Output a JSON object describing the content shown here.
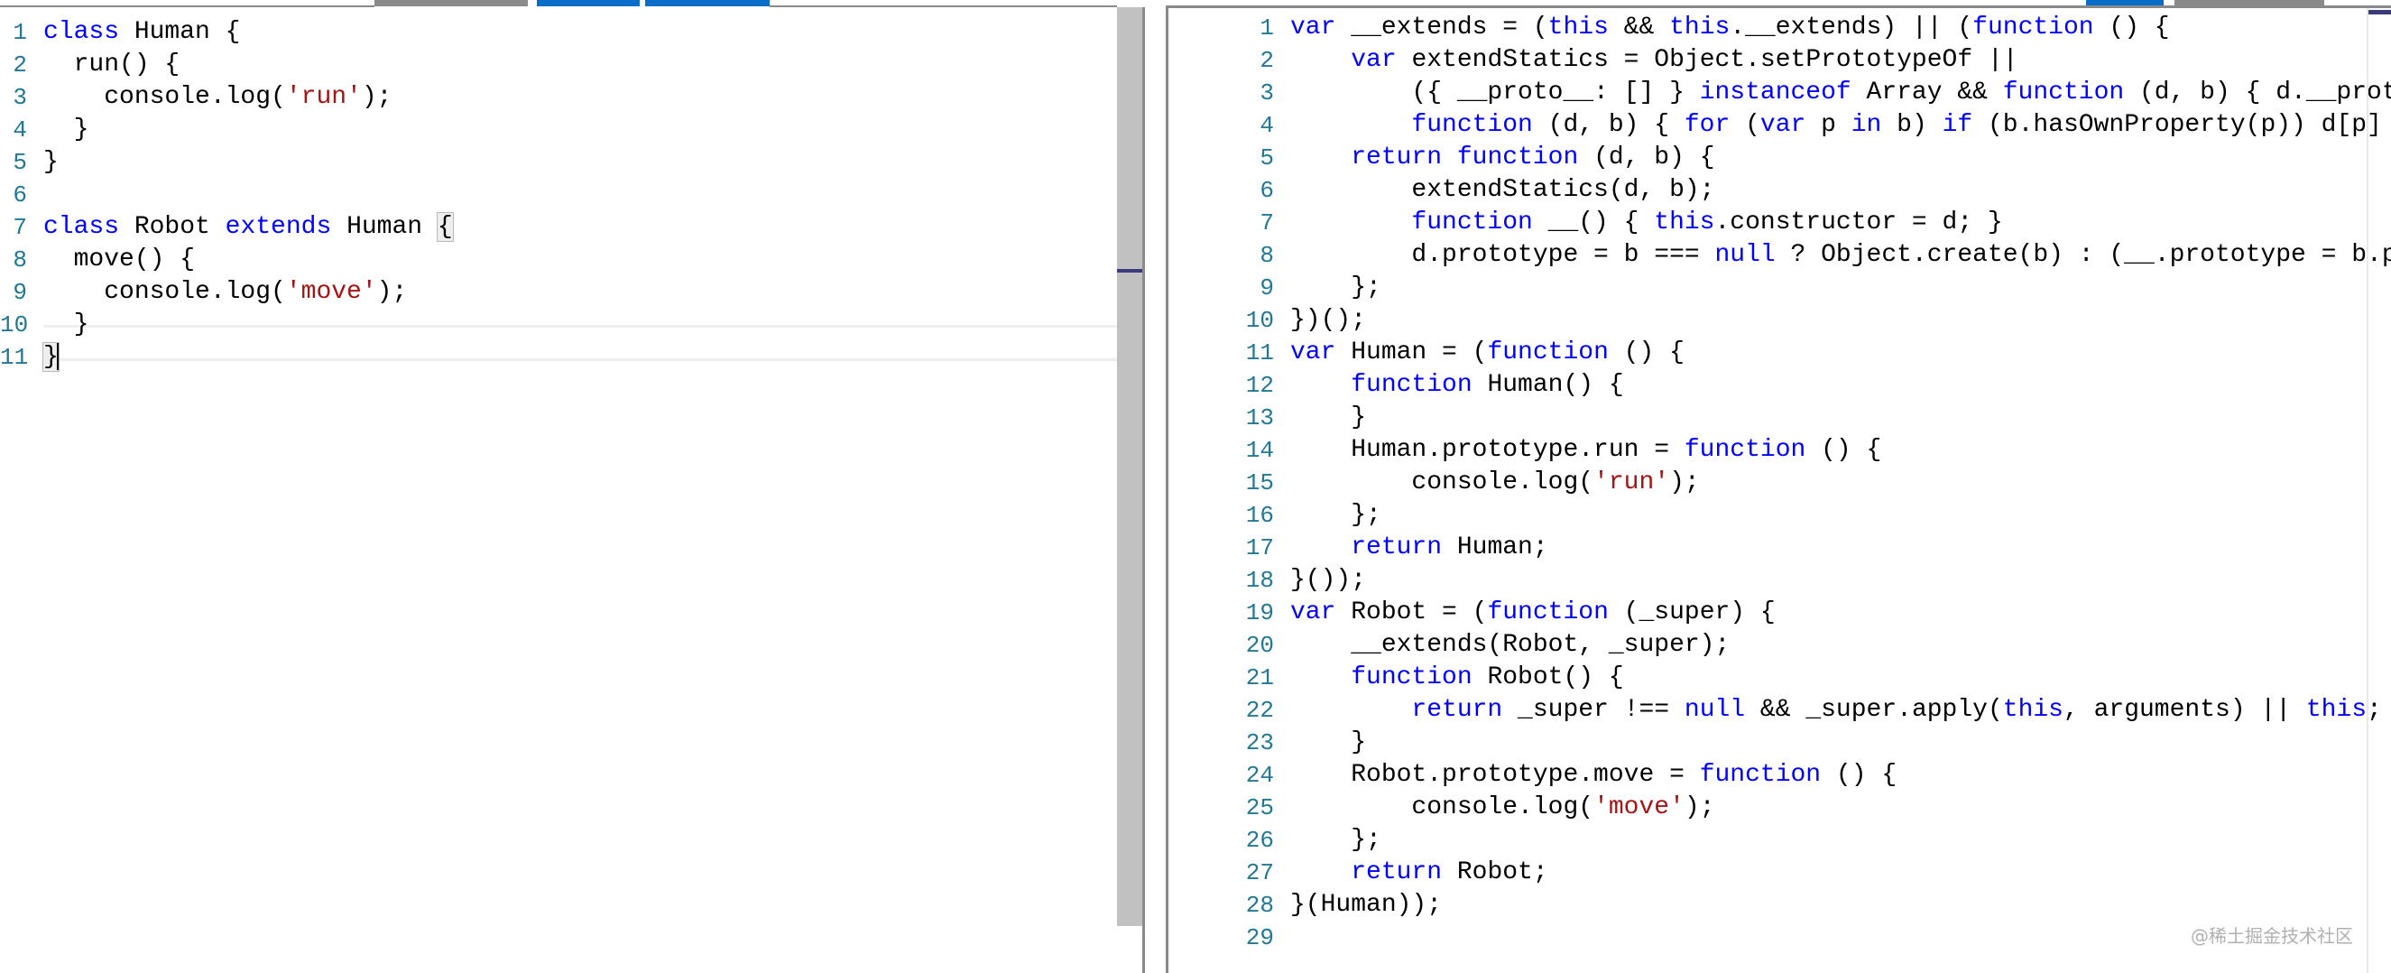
{
  "left_editor": {
    "language": "TypeScript",
    "cursor_line": 11,
    "lines": [
      {
        "n": "1",
        "tokens": [
          {
            "t": "class",
            "c": "kw"
          },
          {
            "t": " Human {"
          }
        ]
      },
      {
        "n": "2",
        "tokens": [
          {
            "t": "  run() {"
          }
        ]
      },
      {
        "n": "3",
        "tokens": [
          {
            "t": "    console.log("
          },
          {
            "t": "'run'",
            "c": "str"
          },
          {
            "t": ");"
          }
        ]
      },
      {
        "n": "4",
        "tokens": [
          {
            "t": "  }"
          }
        ]
      },
      {
        "n": "5",
        "tokens": [
          {
            "t": "}"
          }
        ]
      },
      {
        "n": "6",
        "tokens": []
      },
      {
        "n": "7",
        "tokens": [
          {
            "t": "class",
            "c": "kw"
          },
          {
            "t": " Robot "
          },
          {
            "t": "extends",
            "c": "kw"
          },
          {
            "t": " Human "
          },
          {
            "t": "{",
            "c": "bracket-match"
          }
        ]
      },
      {
        "n": "8",
        "tokens": [
          {
            "t": "  move() {"
          }
        ]
      },
      {
        "n": "9",
        "tokens": [
          {
            "t": "    console.log("
          },
          {
            "t": "'move'",
            "c": "str"
          },
          {
            "t": ");"
          }
        ]
      },
      {
        "n": "10",
        "tokens": [
          {
            "t": "  }"
          }
        ]
      },
      {
        "n": "11",
        "tokens": [
          {
            "t": "}",
            "c": "bracket-match"
          }
        ]
      }
    ]
  },
  "right_editor": {
    "language": "JavaScript",
    "lines": [
      {
        "n": "1",
        "tokens": [
          {
            "t": "var",
            "c": "kw"
          },
          {
            "t": " __extends = ("
          },
          {
            "t": "this",
            "c": "kw"
          },
          {
            "t": " && "
          },
          {
            "t": "this",
            "c": "kw"
          },
          {
            "t": ".__extends) || ("
          },
          {
            "t": "function",
            "c": "kw"
          },
          {
            "t": " () {"
          }
        ]
      },
      {
        "n": "2",
        "tokens": [
          {
            "t": "    "
          },
          {
            "t": "var",
            "c": "kw"
          },
          {
            "t": " extendStatics = Object.setPrototypeOf ||"
          }
        ]
      },
      {
        "n": "3",
        "tokens": [
          {
            "t": "        ({ __proto__: [] } "
          },
          {
            "t": "instanceof",
            "c": "kw"
          },
          {
            "t": " Array && "
          },
          {
            "t": "function",
            "c": "kw"
          },
          {
            "t": " (d, b) { d.__proto__ = b; }) ||"
          }
        ]
      },
      {
        "n": "4",
        "tokens": [
          {
            "t": "        "
          },
          {
            "t": "function",
            "c": "kw"
          },
          {
            "t": " (d, b) { "
          },
          {
            "t": "for",
            "c": "kw"
          },
          {
            "t": " ("
          },
          {
            "t": "var",
            "c": "kw"
          },
          {
            "t": " p "
          },
          {
            "t": "in",
            "c": "kw"
          },
          {
            "t": " b) "
          },
          {
            "t": "if",
            "c": "kw"
          },
          {
            "t": " (b.hasOwnProperty(p)) d[p] = b[p]; };"
          }
        ]
      },
      {
        "n": "5",
        "tokens": [
          {
            "t": "    "
          },
          {
            "t": "return",
            "c": "kw"
          },
          {
            "t": " "
          },
          {
            "t": "function",
            "c": "kw"
          },
          {
            "t": " (d, b) {"
          }
        ]
      },
      {
        "n": "6",
        "tokens": [
          {
            "t": "        extendStatics(d, b);"
          }
        ]
      },
      {
        "n": "7",
        "tokens": [
          {
            "t": "        "
          },
          {
            "t": "function",
            "c": "kw"
          },
          {
            "t": " __() { "
          },
          {
            "t": "this",
            "c": "kw"
          },
          {
            "t": ".constructor = d; }"
          }
        ]
      },
      {
        "n": "8",
        "tokens": [
          {
            "t": "        d.prototype = b === "
          },
          {
            "t": "null",
            "c": "kw"
          },
          {
            "t": " ? Object.create(b) : (__.prototype = b.prototype, new __());"
          }
        ]
      },
      {
        "n": "9",
        "tokens": [
          {
            "t": "    };"
          }
        ]
      },
      {
        "n": "10",
        "tokens": [
          {
            "t": "})();"
          }
        ]
      },
      {
        "n": "11",
        "tokens": [
          {
            "t": "var",
            "c": "kw"
          },
          {
            "t": " Human = ("
          },
          {
            "t": "function",
            "c": "kw"
          },
          {
            "t": " () {"
          }
        ]
      },
      {
        "n": "12",
        "tokens": [
          {
            "t": "    "
          },
          {
            "t": "function",
            "c": "kw"
          },
          {
            "t": " Human() {"
          }
        ]
      },
      {
        "n": "13",
        "tokens": [
          {
            "t": "    }"
          }
        ]
      },
      {
        "n": "14",
        "tokens": [
          {
            "t": "    Human.prototype.run = "
          },
          {
            "t": "function",
            "c": "kw"
          },
          {
            "t": " () {"
          }
        ]
      },
      {
        "n": "15",
        "tokens": [
          {
            "t": "        console.log("
          },
          {
            "t": "'run'",
            "c": "str"
          },
          {
            "t": ");"
          }
        ]
      },
      {
        "n": "16",
        "tokens": [
          {
            "t": "    };"
          }
        ]
      },
      {
        "n": "17",
        "tokens": [
          {
            "t": "    "
          },
          {
            "t": "return",
            "c": "kw"
          },
          {
            "t": " Human;"
          }
        ]
      },
      {
        "n": "18",
        "tokens": [
          {
            "t": "}());"
          }
        ]
      },
      {
        "n": "19",
        "tokens": [
          {
            "t": "var",
            "c": "kw"
          },
          {
            "t": " Robot = ("
          },
          {
            "t": "function",
            "c": "kw"
          },
          {
            "t": " (_super) {"
          }
        ]
      },
      {
        "n": "20",
        "tokens": [
          {
            "t": "    __extends(Robot, _super);"
          }
        ]
      },
      {
        "n": "21",
        "tokens": [
          {
            "t": "    "
          },
          {
            "t": "function",
            "c": "kw"
          },
          {
            "t": " Robot() {"
          }
        ]
      },
      {
        "n": "22",
        "tokens": [
          {
            "t": "        "
          },
          {
            "t": "return",
            "c": "kw"
          },
          {
            "t": " _super !== "
          },
          {
            "t": "null",
            "c": "kw"
          },
          {
            "t": " && _super.apply("
          },
          {
            "t": "this",
            "c": "kw"
          },
          {
            "t": ", arguments) || "
          },
          {
            "t": "this",
            "c": "kw"
          },
          {
            "t": ";"
          }
        ]
      },
      {
        "n": "23",
        "tokens": [
          {
            "t": "    }"
          }
        ]
      },
      {
        "n": "24",
        "tokens": [
          {
            "t": "    Robot.prototype.move = "
          },
          {
            "t": "function",
            "c": "kw"
          },
          {
            "t": " () {"
          }
        ]
      },
      {
        "n": "25",
        "tokens": [
          {
            "t": "        console.log("
          },
          {
            "t": "'move'",
            "c": "str"
          },
          {
            "t": ");"
          }
        ]
      },
      {
        "n": "26",
        "tokens": [
          {
            "t": "    };"
          }
        ]
      },
      {
        "n": "27",
        "tokens": [
          {
            "t": "    "
          },
          {
            "t": "return",
            "c": "kw"
          },
          {
            "t": " Robot;"
          }
        ]
      },
      {
        "n": "28",
        "tokens": [
          {
            "t": "}(Human));"
          }
        ]
      },
      {
        "n": "29",
        "tokens": []
      }
    ]
  },
  "top_tabs": {
    "indicators": [
      {
        "name": "tab-indicator-gray",
        "color": "#8a8a8a"
      },
      {
        "name": "tab-indicator-blue-1",
        "color": "#0a6ec8"
      },
      {
        "name": "tab-indicator-blue-2",
        "color": "#0a6ec8"
      },
      {
        "name": "tab-indicator-blue-3",
        "color": "#0a6ec8"
      },
      {
        "name": "tab-indicator-gray-2",
        "color": "#8a8a8a"
      }
    ]
  },
  "watermark": "@稀土掘金技术社区",
  "colors": {
    "keyword": "#0000ff",
    "string": "#a31515",
    "line_number": "#237893",
    "scroll_marker": "#3d3a7a"
  }
}
